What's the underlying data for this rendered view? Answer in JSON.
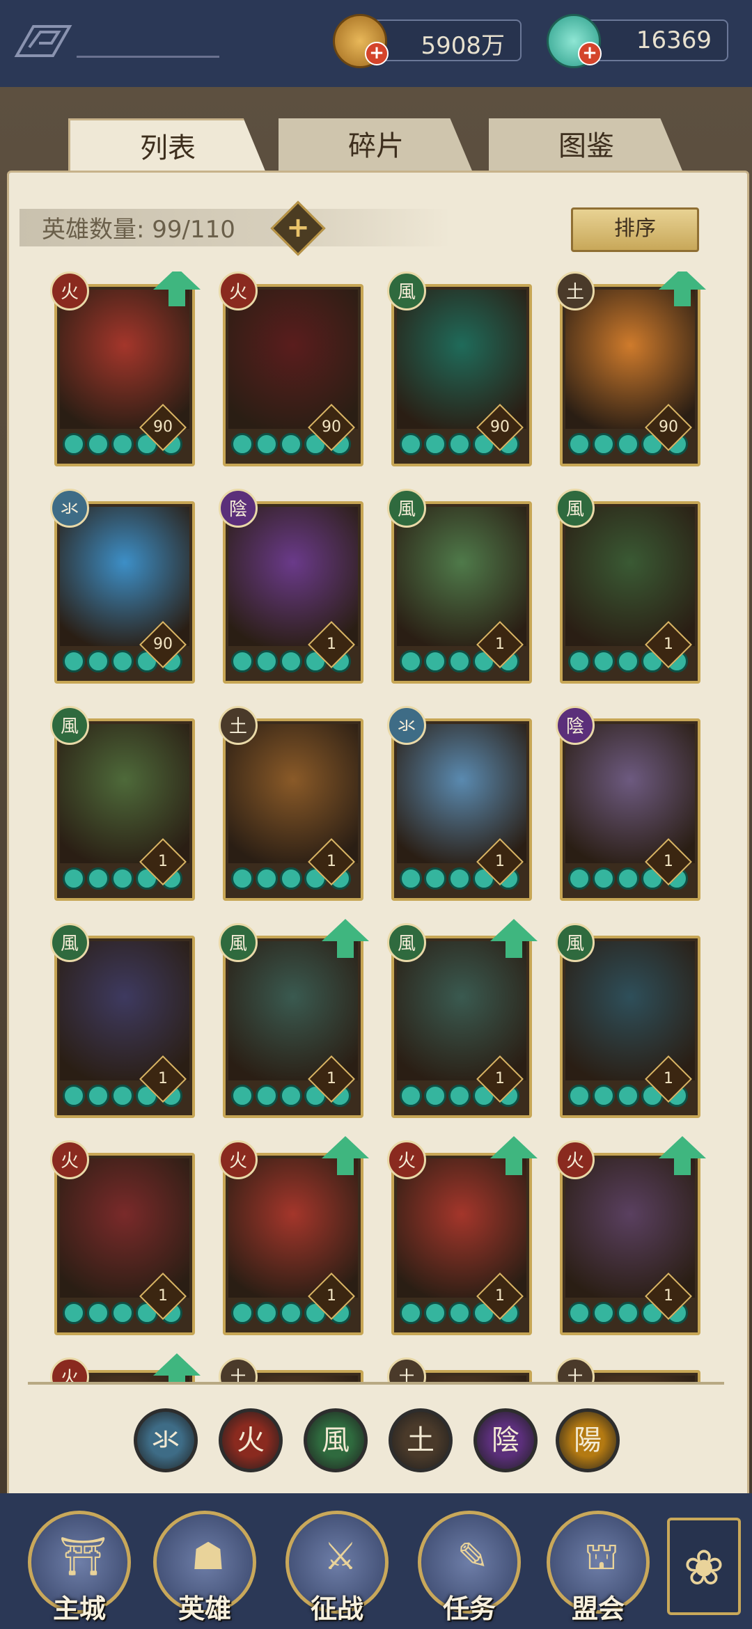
{
  "resources": {
    "coins": {
      "value": "5908万",
      "icon": "copper-coin-icon"
    },
    "jade": {
      "value": "16369",
      "icon": "jade-pouch-icon"
    }
  },
  "tabs": [
    {
      "label": "列表",
      "active": true
    },
    {
      "label": "碎片",
      "active": false
    },
    {
      "label": "图鉴",
      "active": false
    }
  ],
  "hero_count": {
    "text": "英雄数量: 99/110"
  },
  "sort_button": {
    "label": "排序"
  },
  "element_colors": {
    "水": "#3e6c86",
    "火": "#8a2a1f",
    "风": "#2f6a3e",
    "土": "#4a3a2a",
    "阴": "#5b2f7a",
    "阳": "#b47a12"
  },
  "element_glyphs": {
    "水": "氺",
    "火": "火",
    "风": "風",
    "土": "土",
    "阴": "陰",
    "阳": "陽"
  },
  "heroes": [
    {
      "element": "火",
      "level": "90",
      "upgrade": true,
      "portrait": "#a4362b"
    },
    {
      "element": "火",
      "level": "90",
      "upgrade": false,
      "portrait": "#5a1d1d"
    },
    {
      "element": "风",
      "level": "90",
      "upgrade": false,
      "portrait": "#1f6b5a"
    },
    {
      "element": "土",
      "level": "90",
      "upgrade": true,
      "portrait": "#cf7b2c"
    },
    {
      "element": "水",
      "level": "90",
      "upgrade": false,
      "portrait": "#3d8fc7"
    },
    {
      "element": "阴",
      "level": "1",
      "upgrade": false,
      "portrait": "#6a3a8a"
    },
    {
      "element": "风",
      "level": "1",
      "upgrade": false,
      "portrait": "#4f7a4a"
    },
    {
      "element": "风",
      "level": "1",
      "upgrade": false,
      "portrait": "#3a5a34"
    },
    {
      "element": "风",
      "level": "1",
      "upgrade": false,
      "portrait": "#4e6a3a"
    },
    {
      "element": "土",
      "level": "1",
      "upgrade": false,
      "portrait": "#8a5a28"
    },
    {
      "element": "水",
      "level": "1",
      "upgrade": false,
      "portrait": "#5a8ab0"
    },
    {
      "element": "阴",
      "level": "1",
      "upgrade": false,
      "portrait": "#6d5a80"
    },
    {
      "element": "风",
      "level": "1",
      "upgrade": false,
      "portrait": "#3e3a60"
    },
    {
      "element": "风",
      "level": "1",
      "upgrade": true,
      "portrait": "#3a5a50"
    },
    {
      "element": "风",
      "level": "1",
      "upgrade": true,
      "portrait": "#3a5a50"
    },
    {
      "element": "风",
      "level": "1",
      "upgrade": false,
      "portrait": "#2e4f5a"
    },
    {
      "element": "火",
      "level": "1",
      "upgrade": false,
      "portrait": "#7a2a2a"
    },
    {
      "element": "火",
      "level": "1",
      "upgrade": true,
      "portrait": "#a4362b"
    },
    {
      "element": "火",
      "level": "1",
      "upgrade": true,
      "portrait": "#a4362b"
    },
    {
      "element": "火",
      "level": "1",
      "upgrade": true,
      "portrait": "#5a4060"
    },
    {
      "element": "火",
      "level": "",
      "upgrade": true,
      "portrait": "#6a4a30"
    },
    {
      "element": "土",
      "level": "",
      "upgrade": false,
      "portrait": "#6a4a30"
    },
    {
      "element": "土",
      "level": "",
      "upgrade": false,
      "portrait": "#6a4a30"
    },
    {
      "element": "土",
      "level": "",
      "upgrade": false,
      "portrait": "#6a4a30"
    }
  ],
  "element_filters": [
    "水",
    "火",
    "风",
    "土",
    "阴",
    "阳"
  ],
  "nav": [
    {
      "label": "主城",
      "icon": "city-gate-icon",
      "glyph": "⛩"
    },
    {
      "label": "英雄",
      "icon": "hero-portrait-icon",
      "glyph": "☗"
    },
    {
      "label": "征战",
      "icon": "battle-icon",
      "glyph": "⚔"
    },
    {
      "label": "任务",
      "icon": "task-scroll-icon",
      "glyph": "✎"
    },
    {
      "label": "盟会",
      "icon": "alliance-icon",
      "glyph": "⛫"
    }
  ],
  "menu_icon": "menu-flower-icon"
}
